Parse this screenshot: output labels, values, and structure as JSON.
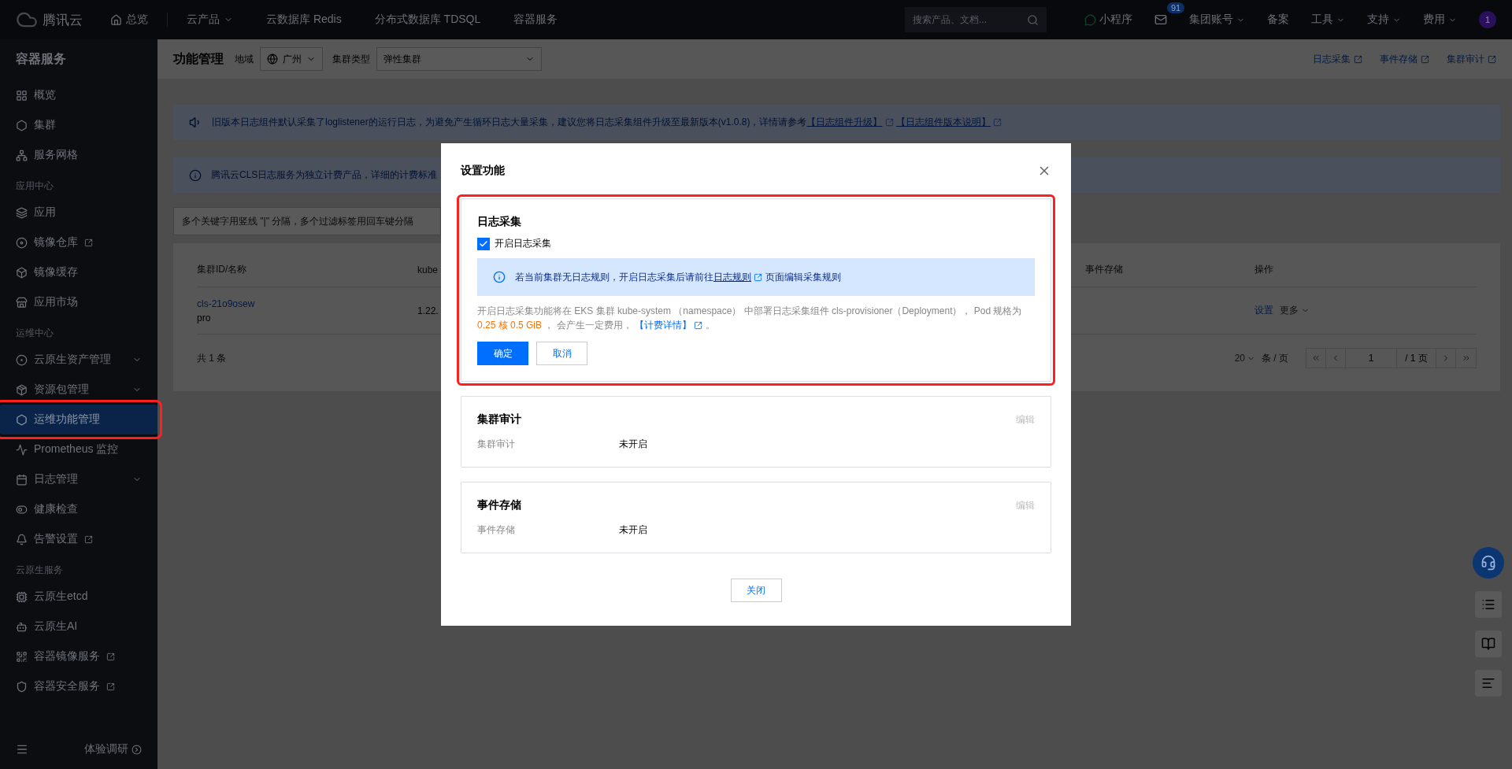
{
  "topbar": {
    "logo": "腾讯云",
    "nav": [
      {
        "label": "总览",
        "kind": "home"
      },
      {
        "label": "云产品",
        "kind": "dropdown"
      },
      {
        "label": "云数据库 Redis",
        "kind": "plain"
      },
      {
        "label": "分布式数据库 TDSQL",
        "kind": "plain"
      },
      {
        "label": "容器服务",
        "kind": "plain"
      }
    ],
    "search": {
      "placeholder": "搜索产品、文档..."
    },
    "miniapp": "小程序",
    "mail_badge": "91",
    "menu": [
      {
        "label": "集团账号",
        "dropdown": true
      },
      {
        "label": "备案",
        "dropdown": false
      },
      {
        "label": "工具",
        "dropdown": true
      },
      {
        "label": "支持",
        "dropdown": true
      },
      {
        "label": "费用",
        "dropdown": true
      }
    ],
    "avatar": "1"
  },
  "sidebar": {
    "title": "容器服务",
    "groups": [
      {
        "items": [
          {
            "label": "概览",
            "external": false,
            "expandable": false,
            "selected": false,
            "highlighted": false
          },
          {
            "label": "集群",
            "external": false,
            "expandable": false,
            "selected": false,
            "highlighted": false
          },
          {
            "label": "服务网格",
            "external": false,
            "expandable": false,
            "selected": false,
            "highlighted": false
          }
        ]
      },
      {
        "heading": "应用中心",
        "items": [
          {
            "label": "应用",
            "external": false,
            "expandable": false,
            "selected": false,
            "highlighted": false
          },
          {
            "label": "镜像仓库",
            "external": true,
            "expandable": false,
            "selected": false,
            "highlighted": false
          },
          {
            "label": "镜像缓存",
            "external": false,
            "expandable": false,
            "selected": false,
            "highlighted": false
          },
          {
            "label": "应用市场",
            "external": false,
            "expandable": false,
            "selected": false,
            "highlighted": false
          }
        ]
      },
      {
        "heading": "运维中心",
        "items": [
          {
            "label": "云原生资产管理",
            "external": false,
            "expandable": true,
            "selected": false,
            "highlighted": false
          },
          {
            "label": "资源包管理",
            "external": false,
            "expandable": true,
            "selected": false,
            "highlighted": false
          },
          {
            "label": "运维功能管理",
            "external": false,
            "expandable": false,
            "selected": true,
            "highlighted": true
          },
          {
            "label": "Prometheus 监控",
            "external": false,
            "expandable": false,
            "selected": false,
            "highlighted": false
          },
          {
            "label": "日志管理",
            "external": false,
            "expandable": true,
            "selected": false,
            "highlighted": false
          },
          {
            "label": "健康检查",
            "external": false,
            "expandable": false,
            "selected": false,
            "highlighted": false
          },
          {
            "label": "告警设置",
            "external": true,
            "expandable": false,
            "selected": false,
            "highlighted": false
          }
        ]
      },
      {
        "heading": "云原生服务",
        "items": [
          {
            "label": "云原生etcd",
            "external": false,
            "expandable": false,
            "selected": false,
            "highlighted": false
          },
          {
            "label": "云原生AI",
            "external": false,
            "expandable": false,
            "selected": false,
            "highlighted": false
          },
          {
            "label": "容器镜像服务",
            "external": true,
            "expandable": false,
            "selected": false,
            "highlighted": false
          },
          {
            "label": "容器安全服务",
            "external": true,
            "expandable": false,
            "selected": false,
            "highlighted": false
          }
        ]
      }
    ],
    "footer": "体验调研"
  },
  "main": {
    "title": "功能管理",
    "filters": [
      {
        "label": "地域",
        "value": "广州",
        "kind": "region"
      },
      {
        "label": "集群类型",
        "value": "弹性集群",
        "kind": "plain"
      }
    ],
    "links": [
      "日志采集",
      "事件存储",
      "集群审计"
    ],
    "notices": [
      {
        "kind": "speaker",
        "parts": [
          {
            "kind": "text",
            "text": "旧版本日志组件默认采集了loglistener的运行日志，为避免产生循环日志大量采集，建议您将日志采集组件升级至最新版本(v1.0.8)，详情请参考"
          },
          {
            "kind": "link",
            "text": "【日志组件升级】"
          },
          {
            "kind": "link",
            "text": "【日志组件版本说明】"
          }
        ]
      },
      {
        "kind": "info",
        "parts": [
          {
            "kind": "text",
            "text": "腾讯云CLS日志服务为独立计费产品，详细的计费标准"
          }
        ]
      }
    ],
    "search": {
      "placeholder": "多个关键字用竖线 \"|\" 分隔，多个过滤标签用回车键分隔"
    },
    "table": {
      "columns": [
        "集群ID/名称",
        "kube",
        "事件存储",
        "操作"
      ],
      "rows": [
        {
          "id": "cls-21o9osew",
          "name": "pro",
          "column_2": "1.22.",
          "actions": [
            "设置",
            "更多"
          ]
        }
      ],
      "total": "共 1 条",
      "page_size": "20",
      "page_size_unit": "条 / 页",
      "page": "1",
      "page_count": "/ 1 页"
    }
  },
  "modal": {
    "title": "设置功能",
    "sections": [
      {
        "kind": "form",
        "title": "日志采集",
        "highlighted": true,
        "checkbox": {
          "label": "开启日志采集",
          "checked": true
        },
        "alert": [
          {
            "kind": "text",
            "text": "若当前集群无日志规则，开启日志采集后请前往"
          },
          {
            "kind": "link",
            "text": "日志规则"
          },
          {
            "kind": "text",
            "text": "页面编辑采集规则"
          }
        ],
        "description": [
          {
            "kind": "text",
            "text": "开启日志采集功能将在 EKS 集群 kube-system （namespace） 中部署日志采集组件 cls-provisioner（Deployment）， Pod 规格为 "
          },
          {
            "kind": "emphasis",
            "text": "0.25 核 0.5 GiB"
          },
          {
            "kind": "text",
            "text": " ， 会产生一定费用， "
          },
          {
            "kind": "link",
            "text": "【计费详情】"
          },
          {
            "kind": "text",
            "text": " 。"
          }
        ],
        "buttons": [
          {
            "label": "确定",
            "primary": true
          },
          {
            "label": "取消",
            "primary": false
          }
        ]
      },
      {
        "kind": "view",
        "title": "集群审计",
        "highlighted": false,
        "edit": {
          "label": "编辑",
          "disabled": true
        },
        "fields": [
          {
            "label": "集群审计",
            "value": "未开启"
          }
        ]
      },
      {
        "kind": "view",
        "title": "事件存储",
        "highlighted": false,
        "edit": {
          "label": "编辑",
          "disabled": true
        },
        "fields": [
          {
            "label": "事件存储",
            "value": "未开启"
          }
        ]
      }
    ],
    "close_button": "关闭"
  }
}
